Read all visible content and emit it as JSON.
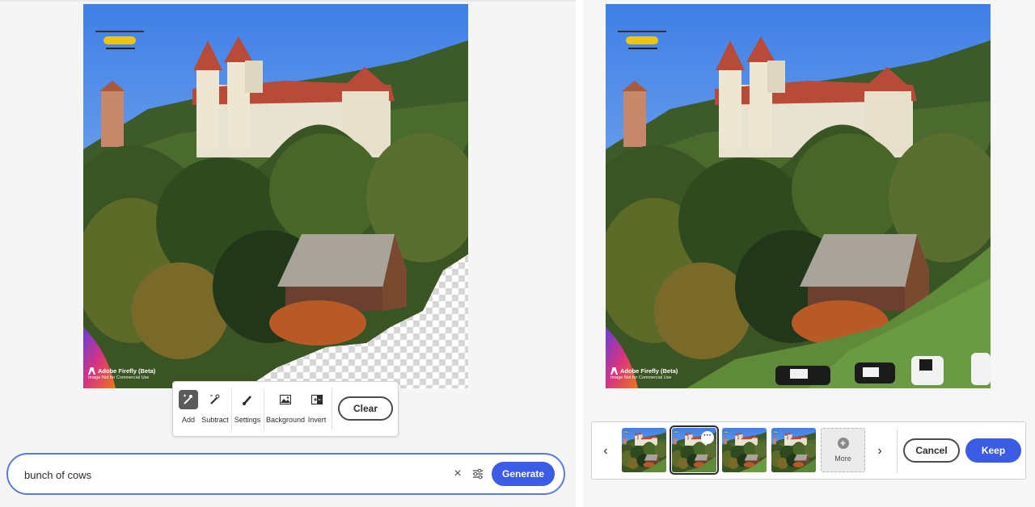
{
  "colors": {
    "accent": "#3d5ce6",
    "prompt_border": "#5c78e6",
    "sky": "#4f8ee8",
    "grass": "#5e8a3a"
  },
  "left_panel": {
    "watermark": {
      "title": "Adobe Firefly (Beta)",
      "subtitle": "Image Not for Commercial Use"
    },
    "selection_toolbar": {
      "tools": [
        {
          "label": "Add",
          "icon": "add-brush-icon",
          "active": true
        },
        {
          "label": "Subtract",
          "icon": "subtract-brush-icon",
          "active": false
        },
        {
          "label": "Settings",
          "icon": "brush-settings-icon",
          "active": false
        },
        {
          "label": "Background",
          "icon": "background-image-icon",
          "active": false
        },
        {
          "label": "Invert",
          "icon": "invert-icon",
          "active": false
        }
      ],
      "clear_label": "Clear"
    },
    "prompt": {
      "value": "bunch of cows",
      "clear_icon": "close-icon",
      "settings_icon": "sliders-icon",
      "generate_label": "Generate"
    }
  },
  "right_panel": {
    "watermark": {
      "title": "Adobe Firefly (Beta)",
      "subtitle": "Image Not for Commercial Use"
    },
    "variations": {
      "prev_icon": "chevron-left-icon",
      "next_icon": "chevron-right-icon",
      "selected_index": 1,
      "thumbnail_count": 4,
      "more_label": "More",
      "cancel_label": "Cancel",
      "keep_label": "Keep"
    }
  }
}
